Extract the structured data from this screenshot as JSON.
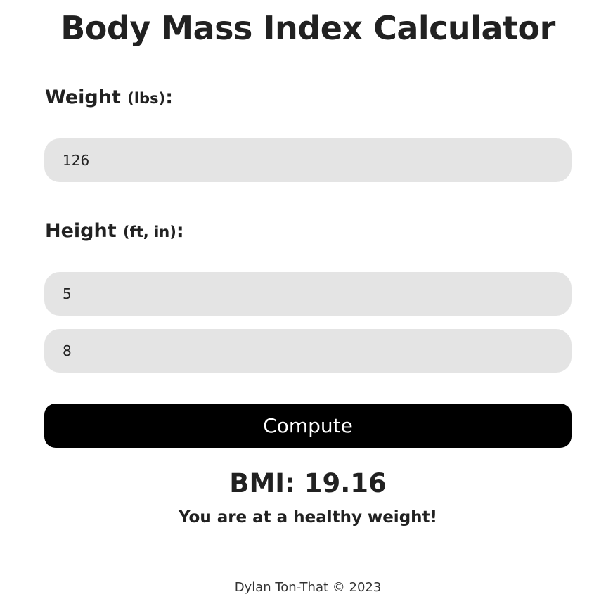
{
  "page": {
    "title": "Body Mass Index Calculator"
  },
  "weight": {
    "label": "Weight",
    "unit": "(lbs)",
    "colon": ":",
    "value": "126"
  },
  "height": {
    "label": "Height",
    "unit": "(ft, in)",
    "colon": ":",
    "feet_value": "5",
    "inches_value": "8"
  },
  "compute_button": {
    "label": "Compute"
  },
  "result": {
    "bmi_text": "BMI: 19.16",
    "message": "You are at a healthy weight!"
  },
  "footer": {
    "text": "Dylan Ton-That © 2023"
  },
  "colors": {
    "input_background": "#e4e4e4",
    "button_background": "#000000",
    "button_text": "#ffffff",
    "text": "#212121"
  }
}
